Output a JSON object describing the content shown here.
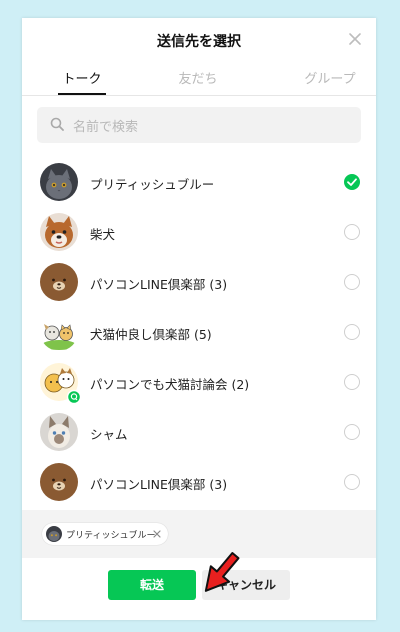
{
  "dialog": {
    "title": "送信先を選択",
    "tabs": [
      {
        "label": "トーク",
        "active": true
      },
      {
        "label": "友だち",
        "active": false
      },
      {
        "label": "グループ",
        "active": false
      }
    ],
    "search_placeholder": "名前で検索",
    "items": [
      {
        "name": "プリティッシュブルー",
        "selected": true,
        "avatar": "gray-cat-avatar"
      },
      {
        "name": "柴犬",
        "selected": false,
        "avatar": "shiba-dog-avatar"
      },
      {
        "name": "パソコンLINE倶楽部 (3)",
        "selected": false,
        "avatar": "brown-bear-avatar"
      },
      {
        "name": "犬猫仲良し倶楽部 (5)",
        "selected": false,
        "avatar": "dog-cat-group-avatar"
      },
      {
        "name": "パソコンでも犬猫討論会 (2)",
        "selected": false,
        "avatar": "dog-cat-open-chat-avatar"
      },
      {
        "name": "シャム",
        "selected": false,
        "avatar": "siamese-cat-avatar"
      },
      {
        "name": "パソコンLINE倶楽部 (3)",
        "selected": false,
        "avatar": "brown-bear-avatar"
      }
    ],
    "selected_chip": {
      "label": "プリティッシュブルー"
    },
    "buttons": {
      "send": "転送",
      "cancel": "キャンセル"
    }
  },
  "colors": {
    "background": "#cfeff6",
    "accent_green": "#06c755",
    "arrow_red": "#e8201f"
  }
}
